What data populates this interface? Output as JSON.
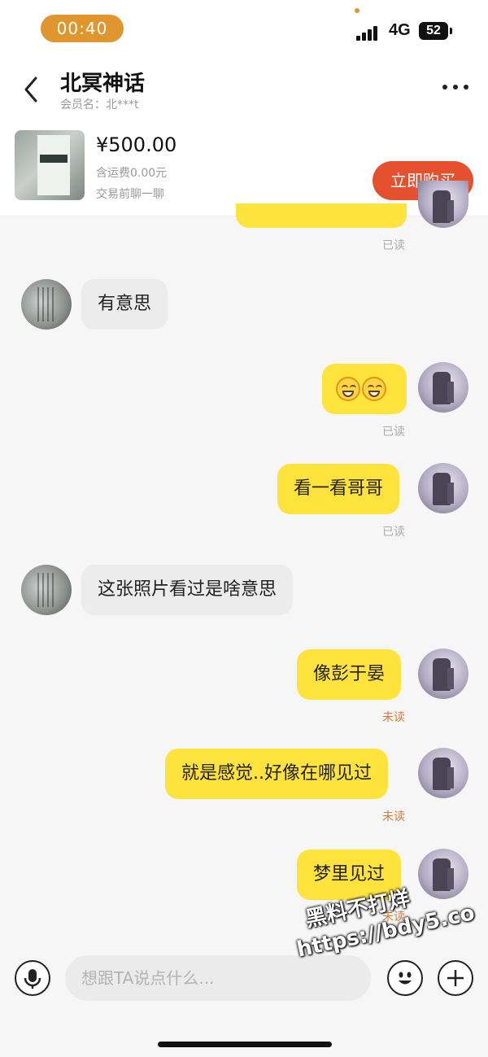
{
  "status_bar": {
    "time": "00:40",
    "network": "4G",
    "battery": "52"
  },
  "header": {
    "title": "北冥神话",
    "member": "会员名：北***t",
    "product": {
      "price": "¥500.00",
      "shipping": "含运费0.00元",
      "note": "交易前聊一聊",
      "buy_label": "立即购买"
    }
  },
  "messages": [
    {
      "side": "right",
      "text": "",
      "status": "已读",
      "partial": true
    },
    {
      "side": "left",
      "text": "有意思"
    },
    {
      "side": "right",
      "text": "",
      "emoji": [
        "grin-squint-icon",
        "grin-squint-icon"
      ],
      "status": "已读"
    },
    {
      "side": "right",
      "text": "看一看哥哥",
      "status": "已读"
    },
    {
      "side": "left",
      "text": "这张照片看过是啥意思"
    },
    {
      "side": "right",
      "text": "像彭于晏",
      "status": "未读"
    },
    {
      "side": "right",
      "text": "就是感觉..好像在哪见过",
      "status": "未读"
    },
    {
      "side": "right",
      "text": "梦里见过",
      "status": "未读"
    }
  ],
  "input": {
    "placeholder": "想跟TA说点什么..."
  },
  "watermark": {
    "line1": "黑料不打烊",
    "line2": "https://bdy5.co"
  },
  "colors": {
    "my_bubble": "#ffe33d",
    "their_bubble": "#ececec",
    "buy_button": "#e5502e",
    "time_pill": "#e0962e",
    "unread": "#d77a3a"
  }
}
